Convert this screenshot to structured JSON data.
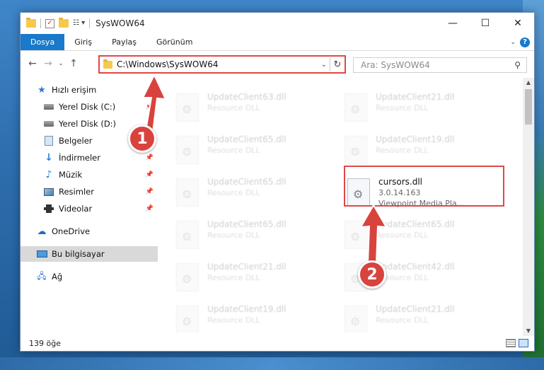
{
  "window": {
    "title": "SysWOW64",
    "buttons": {
      "minimize": "—",
      "maximize": "☐",
      "close": "✕"
    }
  },
  "ribbon": {
    "tabs": [
      {
        "label": "Dosya",
        "active": true
      },
      {
        "label": "Giriş"
      },
      {
        "label": "Paylaş"
      },
      {
        "label": "Görünüm"
      }
    ],
    "help": "?"
  },
  "navigation": {
    "back": "←",
    "forward": "→",
    "recent": "⌄",
    "up": "↑",
    "address_path": "C:\\Windows\\SysWOW64",
    "address_dropdown": "⌄",
    "refresh": "↻",
    "search_placeholder": "Ara: SysWOW64"
  },
  "sidebar": {
    "items": [
      {
        "label": "Hızlı erişim",
        "icon": "star-icon"
      },
      {
        "label": "Yerel Disk (C:)",
        "icon": "disk-icon",
        "pinned": true
      },
      {
        "label": "Yerel Disk (D:)",
        "icon": "disk-icon",
        "pinned": true
      },
      {
        "label": "Belgeler",
        "icon": "documents-icon",
        "pinned": true
      },
      {
        "label": "İndirmeler",
        "icon": "downloads-icon",
        "pinned": true
      },
      {
        "label": "Müzik",
        "icon": "music-icon",
        "pinned": true
      },
      {
        "label": "Resimler",
        "icon": "pictures-icon",
        "pinned": true
      },
      {
        "label": "Videolar",
        "icon": "videos-icon",
        "pinned": true
      },
      {
        "label": "OneDrive",
        "icon": "onedrive-icon"
      },
      {
        "label": "Bu bilgisayar",
        "icon": "this-pc-icon",
        "selected": true
      },
      {
        "label": "Ağ",
        "icon": "network-icon"
      }
    ]
  },
  "files": [
    {
      "name": "UpdateClient63.dll",
      "sub": "Resource DLL"
    },
    {
      "name": "UpdateClient21.dll",
      "sub": "Resource DLL"
    },
    {
      "name": "UpdateClient65.dll",
      "sub": "Resource DLL"
    },
    {
      "name": "UpdateClient19.dll",
      "sub": "Resource DLL"
    },
    {
      "name": "UpdateClient65.dll",
      "sub": "Resource DLL"
    },
    {
      "name": "cursors.dll",
      "version": "3.0.14.163",
      "description": "Viewpoint Media Pla..."
    },
    {
      "name": "UpdateClient65.dll",
      "sub": "Resource DLL"
    },
    {
      "name": "UpdateClient65.dll",
      "sub": "Resource DLL"
    },
    {
      "name": "UpdateClient21.dll",
      "sub": "Resource DLL"
    },
    {
      "name": "UpdateClient42.dll",
      "sub": "Resource DLL"
    },
    {
      "name": "UpdateClient19.dll",
      "sub": "Resource DLL"
    },
    {
      "name": "UpdateClient21.dll",
      "sub": "Resource DLL"
    }
  ],
  "status": {
    "item_count": "139 öğe"
  },
  "annotations": {
    "step1": "1",
    "step2": "2",
    "color": "#d8433e"
  }
}
